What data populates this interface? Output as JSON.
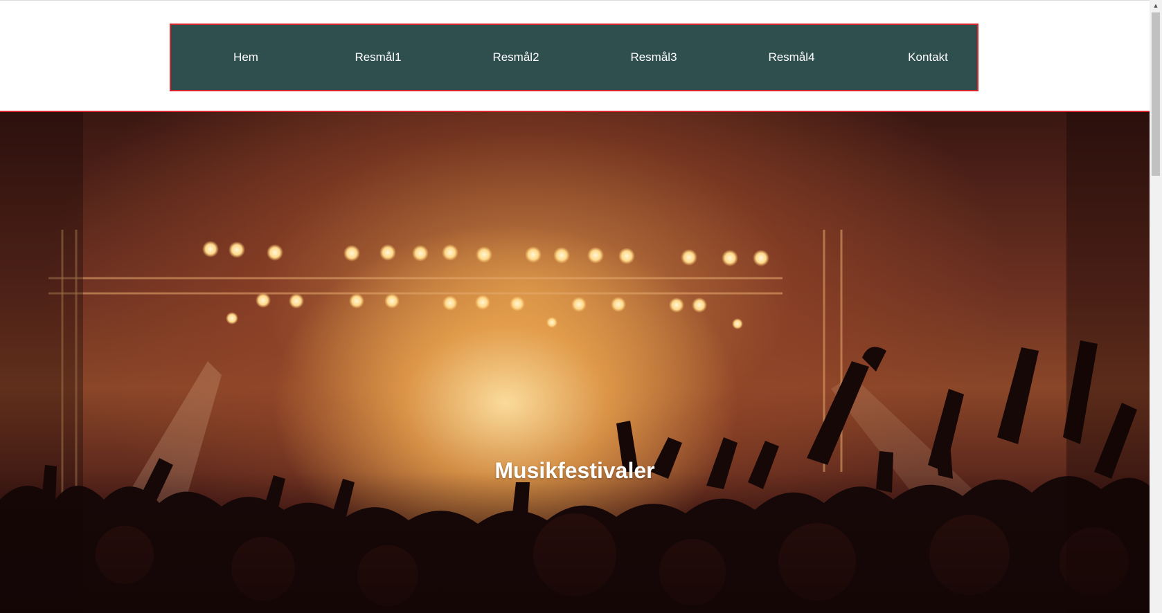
{
  "nav": {
    "items": [
      {
        "label": "Hem"
      },
      {
        "label": "Resmål1"
      },
      {
        "label": "Resmål2"
      },
      {
        "label": "Resmål3"
      },
      {
        "label": "Resmål4"
      },
      {
        "label": "Kontakt"
      }
    ]
  },
  "hero": {
    "title": "Musikfestivaler"
  },
  "colors": {
    "nav_background": "#2f4f4f",
    "accent_border": "#d8262f",
    "nav_text": "#ffffff"
  },
  "scrollbar": {
    "up_arrow_icon": "arrow-up-icon"
  }
}
